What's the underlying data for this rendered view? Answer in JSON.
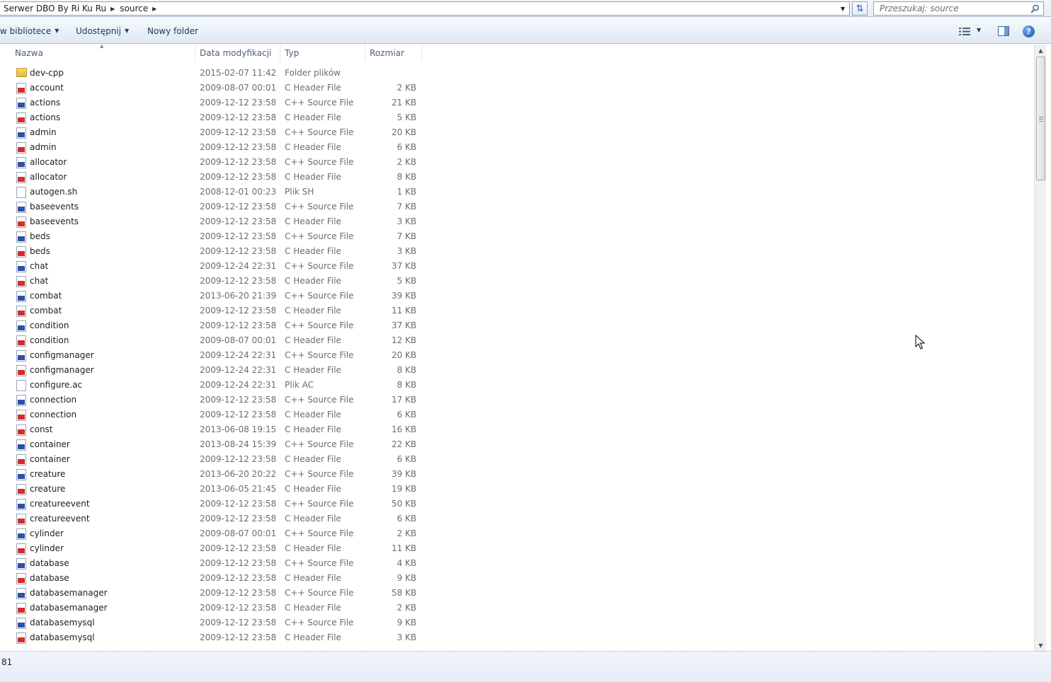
{
  "breadcrumb": [
    {
      "label": "Serwer DBO By Ri Ku Ru"
    },
    {
      "label": "source"
    }
  ],
  "search": {
    "placeholder": "Przeszukaj: source"
  },
  "toolbar": {
    "include_library_label": "w bibliotece",
    "share_label": "Udostępnij",
    "new_folder_label": "Nowy folder"
  },
  "columns": {
    "name": "Nazwa",
    "date": "Data modyfikacji",
    "type": "Typ",
    "size": "Rozmiar"
  },
  "files": [
    {
      "name": "dev-cpp",
      "date": "2015-02-07 11:42",
      "type": "Folder plików",
      "size": "",
      "icon": "folder-icon"
    },
    {
      "name": "account",
      "date": "2009-08-07 00:01",
      "type": "C Header File",
      "size": "2 KB",
      "icon": "h-file-icon"
    },
    {
      "name": "actions",
      "date": "2009-12-12 23:58",
      "type": "C++ Source File",
      "size": "21 KB",
      "icon": "cpp-file-icon"
    },
    {
      "name": "actions",
      "date": "2009-12-12 23:58",
      "type": "C Header File",
      "size": "5 KB",
      "icon": "h-file-icon"
    },
    {
      "name": "admin",
      "date": "2009-12-12 23:58",
      "type": "C++ Source File",
      "size": "20 KB",
      "icon": "cpp-file-icon"
    },
    {
      "name": "admin",
      "date": "2009-12-12 23:58",
      "type": "C Header File",
      "size": "6 KB",
      "icon": "h-file-icon"
    },
    {
      "name": "allocator",
      "date": "2009-12-12 23:58",
      "type": "C++ Source File",
      "size": "2 KB",
      "icon": "cpp-file-icon"
    },
    {
      "name": "allocator",
      "date": "2009-12-12 23:58",
      "type": "C Header File",
      "size": "8 KB",
      "icon": "h-file-icon"
    },
    {
      "name": "autogen.sh",
      "date": "2008-12-01 00:23",
      "type": "Plik SH",
      "size": "1 KB",
      "icon": "text-file-icon"
    },
    {
      "name": "baseevents",
      "date": "2009-12-12 23:58",
      "type": "C++ Source File",
      "size": "7 KB",
      "icon": "cpp-file-icon"
    },
    {
      "name": "baseevents",
      "date": "2009-12-12 23:58",
      "type": "C Header File",
      "size": "3 KB",
      "icon": "h-file-icon"
    },
    {
      "name": "beds",
      "date": "2009-12-12 23:58",
      "type": "C++ Source File",
      "size": "7 KB",
      "icon": "cpp-file-icon"
    },
    {
      "name": "beds",
      "date": "2009-12-12 23:58",
      "type": "C Header File",
      "size": "3 KB",
      "icon": "h-file-icon"
    },
    {
      "name": "chat",
      "date": "2009-12-24 22:31",
      "type": "C++ Source File",
      "size": "37 KB",
      "icon": "cpp-file-icon"
    },
    {
      "name": "chat",
      "date": "2009-12-12 23:58",
      "type": "C Header File",
      "size": "5 KB",
      "icon": "h-file-icon"
    },
    {
      "name": "combat",
      "date": "2013-06-20 21:39",
      "type": "C++ Source File",
      "size": "39 KB",
      "icon": "cpp-file-icon"
    },
    {
      "name": "combat",
      "date": "2009-12-12 23:58",
      "type": "C Header File",
      "size": "11 KB",
      "icon": "h-file-icon"
    },
    {
      "name": "condition",
      "date": "2009-12-12 23:58",
      "type": "C++ Source File",
      "size": "37 KB",
      "icon": "cpp-file-icon"
    },
    {
      "name": "condition",
      "date": "2009-08-07 00:01",
      "type": "C Header File",
      "size": "12 KB",
      "icon": "h-file-icon"
    },
    {
      "name": "configmanager",
      "date": "2009-12-24 22:31",
      "type": "C++ Source File",
      "size": "20 KB",
      "icon": "cpp-file-icon"
    },
    {
      "name": "configmanager",
      "date": "2009-12-24 22:31",
      "type": "C Header File",
      "size": "8 KB",
      "icon": "h-file-icon"
    },
    {
      "name": "configure.ac",
      "date": "2009-12-24 22:31",
      "type": "Plik AC",
      "size": "8 KB",
      "icon": "text-file-icon"
    },
    {
      "name": "connection",
      "date": "2009-12-12 23:58",
      "type": "C++ Source File",
      "size": "17 KB",
      "icon": "cpp-file-icon"
    },
    {
      "name": "connection",
      "date": "2009-12-12 23:58",
      "type": "C Header File",
      "size": "6 KB",
      "icon": "h-file-icon"
    },
    {
      "name": "const",
      "date": "2013-06-08 19:15",
      "type": "C Header File",
      "size": "16 KB",
      "icon": "h-file-icon"
    },
    {
      "name": "container",
      "date": "2013-08-24 15:39",
      "type": "C++ Source File",
      "size": "22 KB",
      "icon": "cpp-file-icon"
    },
    {
      "name": "container",
      "date": "2009-12-12 23:58",
      "type": "C Header File",
      "size": "6 KB",
      "icon": "h-file-icon"
    },
    {
      "name": "creature",
      "date": "2013-06-20 20:22",
      "type": "C++ Source File",
      "size": "39 KB",
      "icon": "cpp-file-icon"
    },
    {
      "name": "creature",
      "date": "2013-06-05 21:45",
      "type": "C Header File",
      "size": "19 KB",
      "icon": "h-file-icon"
    },
    {
      "name": "creatureevent",
      "date": "2009-12-12 23:58",
      "type": "C++ Source File",
      "size": "50 KB",
      "icon": "cpp-file-icon"
    },
    {
      "name": "creatureevent",
      "date": "2009-12-12 23:58",
      "type": "C Header File",
      "size": "6 KB",
      "icon": "h-file-icon"
    },
    {
      "name": "cylinder",
      "date": "2009-08-07 00:01",
      "type": "C++ Source File",
      "size": "2 KB",
      "icon": "cpp-file-icon"
    },
    {
      "name": "cylinder",
      "date": "2009-12-12 23:58",
      "type": "C Header File",
      "size": "11 KB",
      "icon": "h-file-icon"
    },
    {
      "name": "database",
      "date": "2009-12-12 23:58",
      "type": "C++ Source File",
      "size": "4 KB",
      "icon": "cpp-file-icon"
    },
    {
      "name": "database",
      "date": "2009-12-12 23:58",
      "type": "C Header File",
      "size": "9 KB",
      "icon": "h-file-icon"
    },
    {
      "name": "databasemanager",
      "date": "2009-12-12 23:58",
      "type": "C++ Source File",
      "size": "58 KB",
      "icon": "cpp-file-icon"
    },
    {
      "name": "databasemanager",
      "date": "2009-12-12 23:58",
      "type": "C Header File",
      "size": "2 KB",
      "icon": "h-file-icon"
    },
    {
      "name": "databasemysql",
      "date": "2009-12-12 23:58",
      "type": "C++ Source File",
      "size": "9 KB",
      "icon": "cpp-file-icon"
    },
    {
      "name": "databasemysql",
      "date": "2009-12-12 23:58",
      "type": "C Header File",
      "size": "3 KB",
      "icon": "h-file-icon"
    }
  ],
  "status": {
    "text": "81"
  },
  "colors": {
    "header_file_accent": "#d02c2c",
    "cpp_file_accent": "#2f4fa8",
    "folder": "#e5b93c"
  }
}
